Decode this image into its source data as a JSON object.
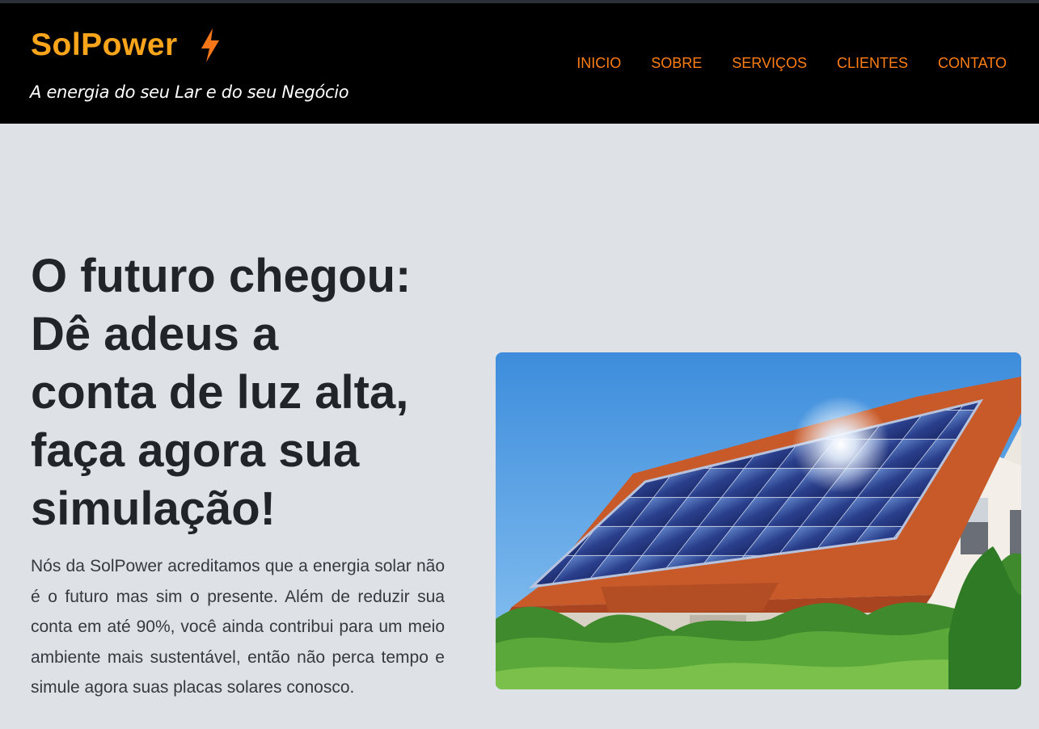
{
  "header": {
    "brand": "SolPower",
    "brand_icon": "lightning-bolt-icon",
    "tagline": "A energia do seu Lar e do seu Negócio",
    "nav": [
      "INICIO",
      "SOBRE",
      "SERVIÇOS",
      "CLIENTES",
      "CONTATO"
    ]
  },
  "hero": {
    "title_lines": [
      "O futuro chegou:",
      "Dê adeus a",
      "conta de luz alta,",
      "faça agora sua",
      "simulação!"
    ],
    "description": "Nós da SolPower acreditamos que a energia solar não é o futuro mas sim o presente. Além de reduzir sua conta em até 90%, você ainda contribui para um meio ambiente mais sustentável, então não perca tempo e simule agora suas placas solares conosco.",
    "image": "house-with-solar-panels-photo"
  },
  "colors": {
    "brand": "#f8a51b",
    "nav": "#fd7e14",
    "header_bg": "#000000",
    "page_bg": "#dee2e6"
  }
}
